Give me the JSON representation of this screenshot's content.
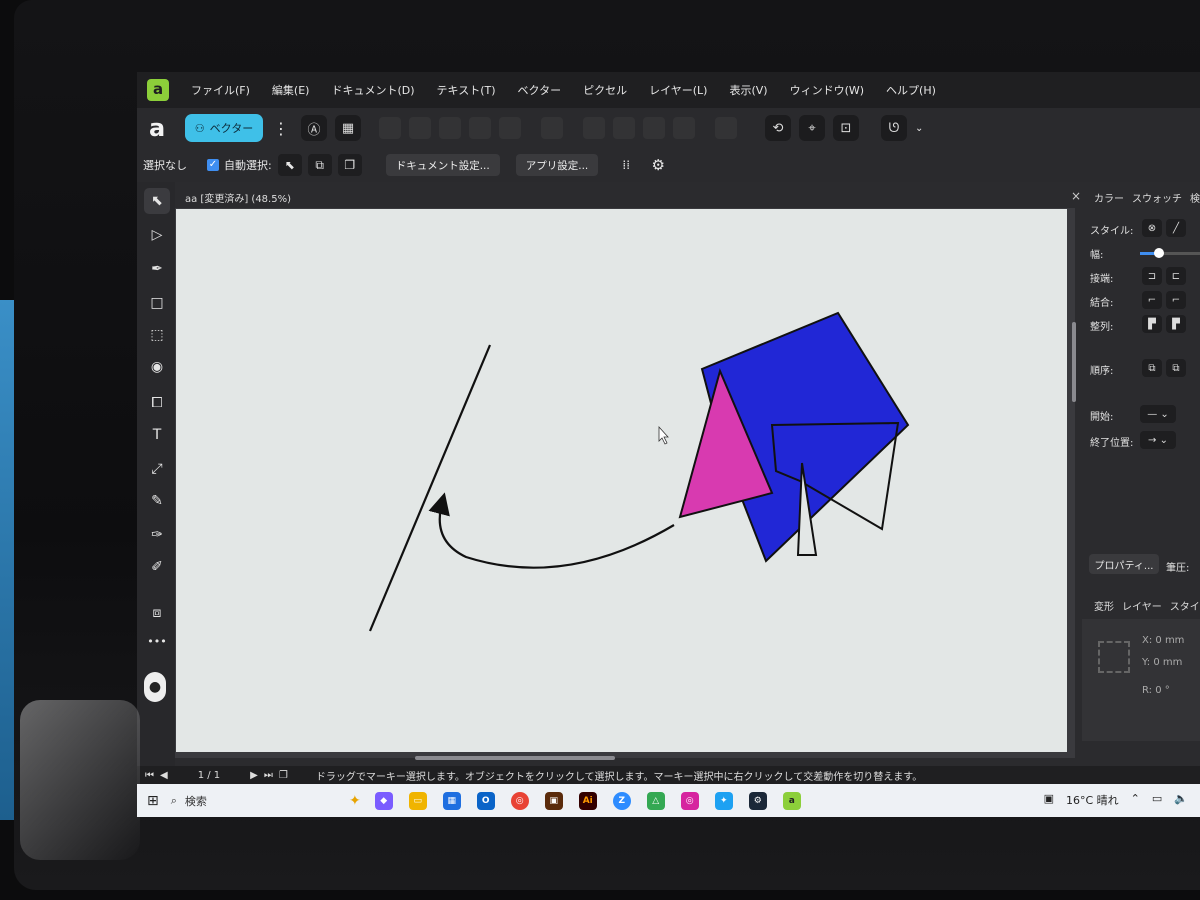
{
  "app": {
    "logo": "a",
    "menu": [
      "ファイル(F)",
      "編集(E)",
      "ドキュメント(D)",
      "テキスト(T)",
      "ベクター",
      "ピクセル",
      "レイヤー(L)",
      "表示(V)",
      "ウィンドウ(W)",
      "ヘルプ(H)"
    ]
  },
  "toolbar": {
    "persona_label": "ベクター",
    "more_icon": "⋮"
  },
  "contextbar": {
    "selection_status": "選択なし",
    "auto_select_label": "自動選択:",
    "document_settings": "ドキュメント設定...",
    "app_settings": "アプリ設定..."
  },
  "document": {
    "title": "aa [変更済み] (48.5%)",
    "close": "×"
  },
  "colors": {
    "artboard": "#e3e7e6",
    "pentagon_fill": "#2127d6",
    "triangle_fill": "#d83ab0",
    "stroke": "#111111",
    "accent": "#3fc0e8"
  },
  "right_panel": {
    "tabs_top": [
      "カラー",
      "スウォッチ",
      "検索"
    ],
    "style_label": "スタイル:",
    "width_label": "幅:",
    "cap_label": "接端:",
    "join_label": "結合:",
    "align_label": "整列:",
    "order_label": "順序:",
    "start_label": "開始:",
    "end_label": "終了位置:",
    "properties_button": "プロパティ...",
    "pressure_label": "筆圧:",
    "tabs_bottom": [
      "変形",
      "レイヤー",
      "スタイル"
    ],
    "transform": {
      "x": "X: 0 mm",
      "y": "Y: 0 mm",
      "r": "R: 0 °"
    }
  },
  "status": {
    "page": "1 / 1",
    "message": "ドラッグでマーキー選択します。オブジェクトをクリックして選択します。マーキー選択中に右クリックして交差動作を切り替えます。"
  },
  "taskbar": {
    "search_placeholder": "検索",
    "weather": "16°C 晴れ",
    "apps": [
      "Copilot",
      "Explorer",
      "Store",
      "Outlook",
      "Chrome",
      "Photo",
      "Ai",
      "Z",
      "Drive",
      "Instagram",
      "Twitter",
      "Steam",
      "Affinity"
    ]
  }
}
